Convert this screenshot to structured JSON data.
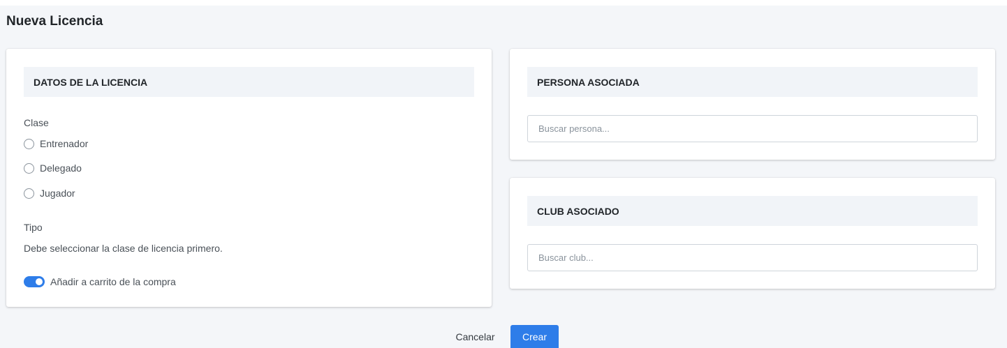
{
  "page": {
    "title": "Nueva Licencia"
  },
  "licencia": {
    "header": "DATOS DE LA LICENCIA",
    "clase_label": "Clase",
    "clase_options": [
      "Entrenador",
      "Delegado",
      "Jugador"
    ],
    "tipo_label": "Tipo",
    "tipo_help": "Debe seleccionar la clase de licencia primero.",
    "carrito_label": "Añadir a carrito de la compra",
    "carrito_enabled": true
  },
  "persona": {
    "header": "PERSONA ASOCIADA",
    "placeholder": "Buscar persona..."
  },
  "club": {
    "header": "CLUB ASOCIADO",
    "placeholder": "Buscar club..."
  },
  "actions": {
    "cancel_label": "Cancelar",
    "create_label": "Crear"
  },
  "colors": {
    "accent": "#2e7de9",
    "page_bg": "#f4f6f9",
    "section_header_bg": "#f1f4f8"
  }
}
